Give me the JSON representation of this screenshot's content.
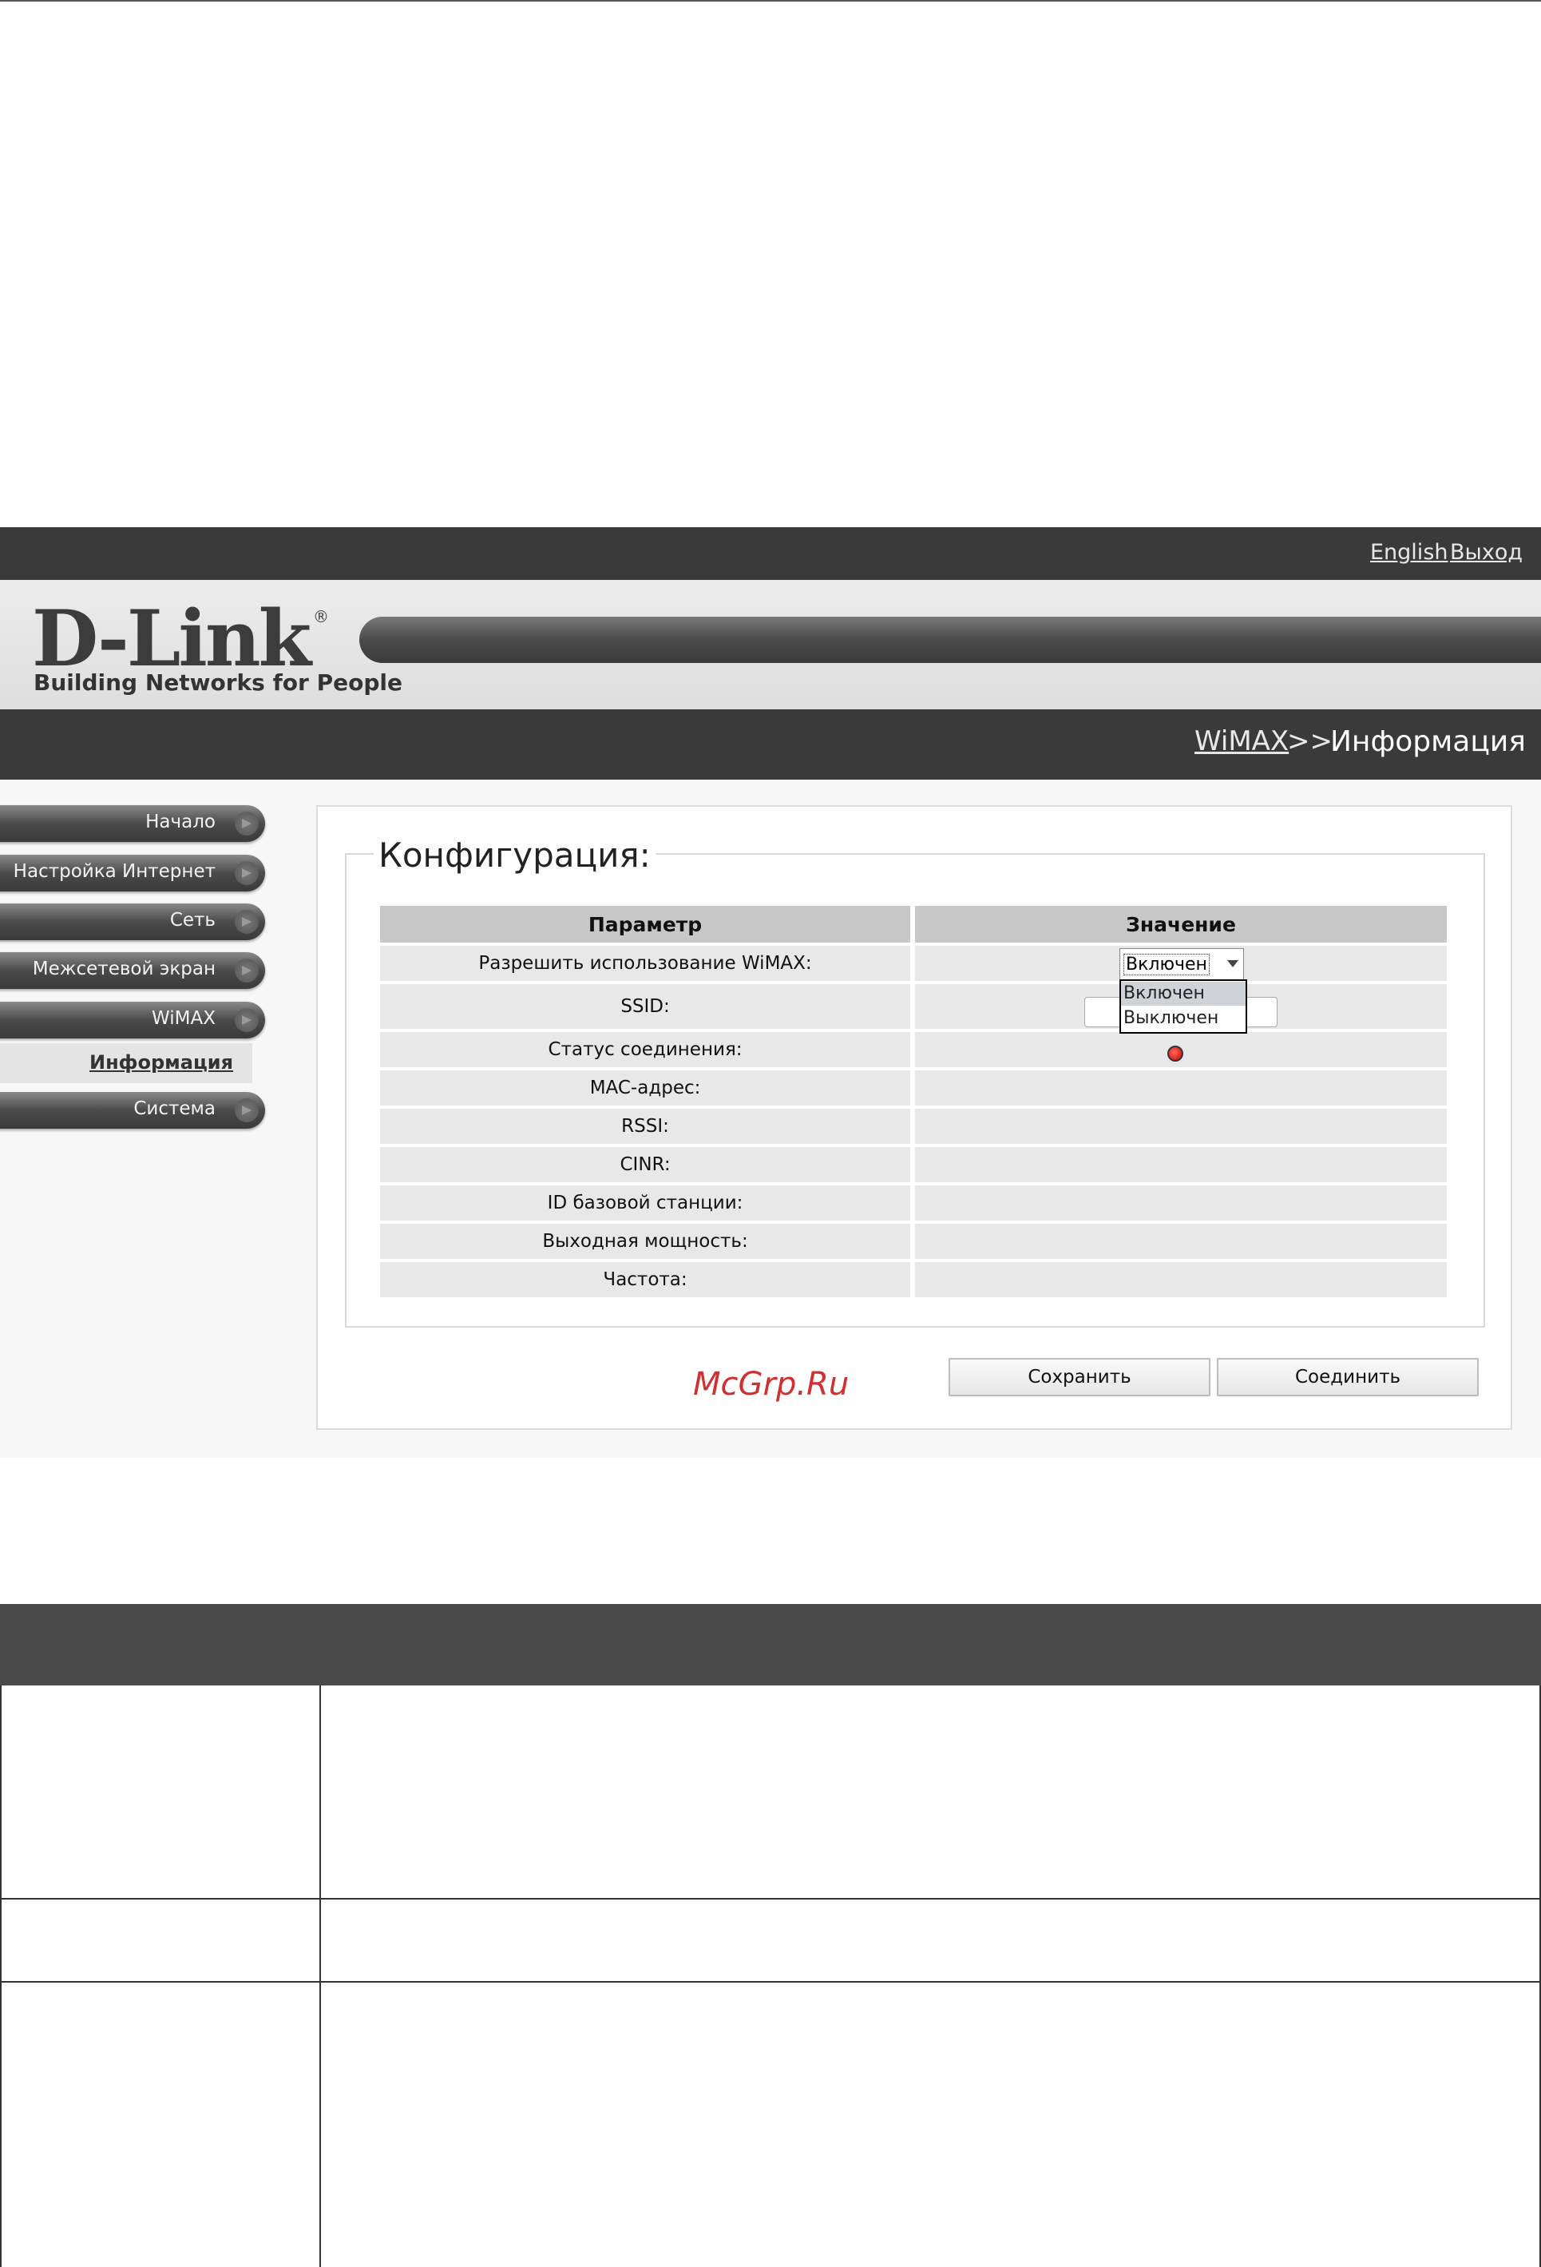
{
  "top_links": {
    "english": "English",
    "logout": "Выход"
  },
  "logo": {
    "brand": "D-Link",
    "registered": "®",
    "tagline": "Building Networks for People"
  },
  "breadcrumb": {
    "section": "WiMAX",
    "separator": ">>",
    "current": "Информация"
  },
  "sidebar": {
    "items": [
      {
        "label": "Начало"
      },
      {
        "label": "Настройка Интернет"
      },
      {
        "label": "Сеть"
      },
      {
        "label": "Межсетевой экран"
      },
      {
        "label": "WiMAX"
      },
      {
        "label": "Система"
      }
    ],
    "subitem": "Информация"
  },
  "config": {
    "title": "Конфигурация:",
    "headers": {
      "param": "Параметр",
      "value": "Значение"
    },
    "rows": [
      {
        "label": "Разрешить использование WiMAX:"
      },
      {
        "label": "SSID:"
      },
      {
        "label": "Статус соединения:"
      },
      {
        "label": "MAC-адрес:"
      },
      {
        "label": "RSSI:"
      },
      {
        "label": "CINR:"
      },
      {
        "label": "ID базовой станции:"
      },
      {
        "label": "Выходная мощность:"
      },
      {
        "label": "Частота:"
      }
    ],
    "wimax_select": {
      "selected": "Включен",
      "options": [
        "Включен",
        "Выключен"
      ]
    },
    "status_color": "#cc0000"
  },
  "buttons": {
    "save": "Сохранить",
    "connect": "Соединить"
  },
  "watermark": "McGrp.Ru"
}
